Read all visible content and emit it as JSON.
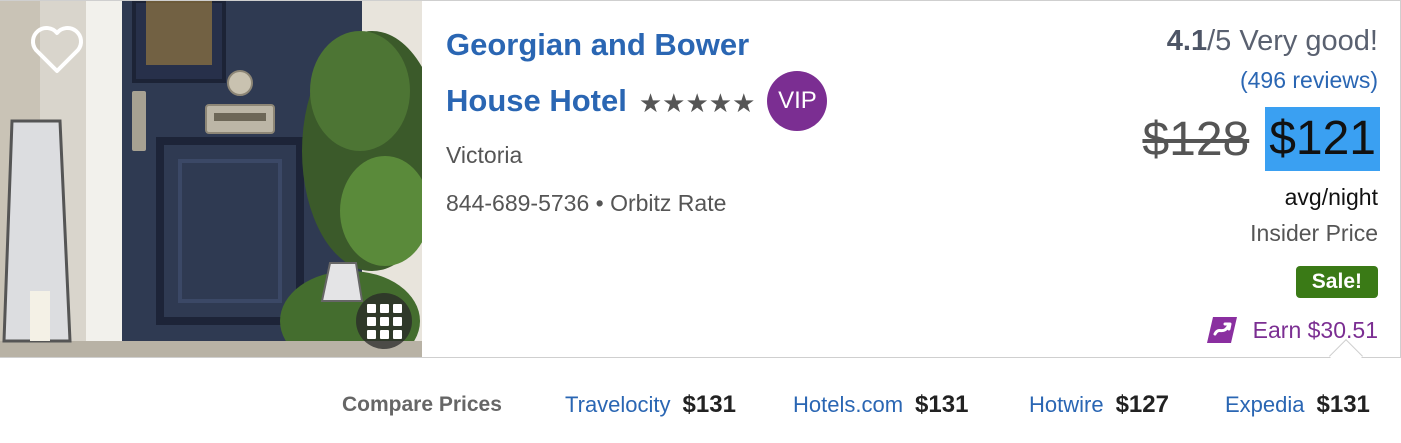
{
  "hotel": {
    "name_line1": "Georgian and Bower",
    "name_line2": "House Hotel",
    "stars": "★★★★★",
    "vip_badge": "VIP",
    "location": "Victoria",
    "phone": "844-689-5736",
    "separator": "•",
    "rate_type": "Orbitz Rate"
  },
  "rating": {
    "score": "4.1",
    "scale": "/5 Very good!",
    "reviews": "(496 reviews)"
  },
  "price": {
    "original": "$128",
    "current": "$121",
    "unit": "avg/night",
    "insider": "Insider Price",
    "sale_badge": "Sale!",
    "earn": "Earn $30.51"
  },
  "compare": {
    "label": "Compare Prices",
    "sites": [
      {
        "name": "Travelocity",
        "price": "$131"
      },
      {
        "name": "Hotels.com",
        "price": "$131"
      },
      {
        "name": "Hotwire",
        "price": "$127"
      },
      {
        "name": "Expedia",
        "price": "$131"
      }
    ]
  },
  "icons": {
    "favorite": "heart-icon",
    "gallery": "grid-icon",
    "rewards": "orbucks-icon"
  },
  "colors": {
    "link_blue": "#2a66b3",
    "vip_purple": "#7b2e92",
    "sale_green": "#3a7a16",
    "price_highlight": "#3aa0f2"
  }
}
